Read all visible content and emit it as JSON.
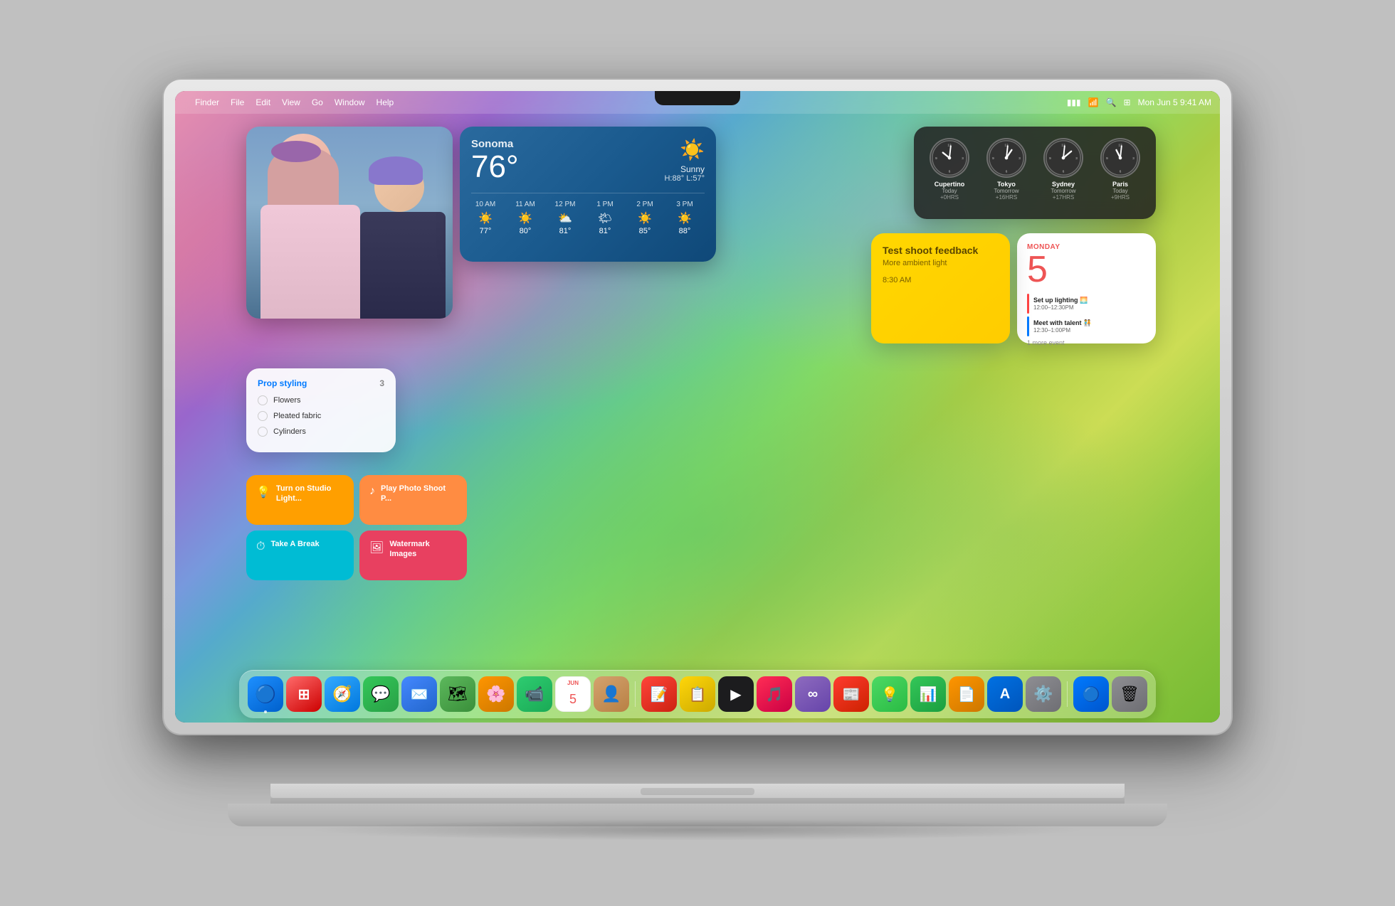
{
  "menubar": {
    "apple": "⌘",
    "finder": "Finder",
    "file": "File",
    "edit": "Edit",
    "view": "View",
    "go": "Go",
    "window": "Window",
    "help": "Help",
    "battery_icon": "🔋",
    "wifi_icon": "wifi",
    "search_icon": "search",
    "control_icon": "ctrl",
    "datetime": "Mon Jun 5  9:41 AM"
  },
  "weather": {
    "location": "Sonoma",
    "temperature": "76°",
    "condition": "Sunny",
    "high": "H:88°",
    "low": "L:57°",
    "forecast": [
      {
        "time": "10 AM",
        "icon": "☀️",
        "temp": "77°"
      },
      {
        "time": "11 AM",
        "icon": "☀️",
        "temp": "80°"
      },
      {
        "time": "12 PM",
        "icon": "⛅",
        "temp": "81°"
      },
      {
        "time": "1 PM",
        "icon": "🌤",
        "temp": "81°"
      },
      {
        "time": "2 PM",
        "icon": "☀️",
        "temp": "85°"
      },
      {
        "time": "3 PM",
        "icon": "☀️",
        "temp": "88°"
      }
    ]
  },
  "clocks": [
    {
      "city": "Cupertino",
      "day": "Today",
      "offset": "+0HRS",
      "hour_angle": "270",
      "min_angle": "300"
    },
    {
      "city": "Tokyo",
      "day": "Tomorrow",
      "offset": "+16HRS",
      "hour_angle": "30",
      "min_angle": "300"
    },
    {
      "city": "Sydney",
      "day": "Tomorrow",
      "offset": "+17HRS",
      "hour_angle": "60",
      "min_angle": "300"
    },
    {
      "city": "Paris",
      "day": "Today",
      "offset": "+9HRS",
      "hour_angle": "330",
      "min_angle": "300"
    }
  ],
  "calendar": {
    "day_name": "MONDAY",
    "date": "5",
    "events": [
      {
        "title": "Set up lighting 🌅",
        "time": "12:00–12:30PM",
        "color": "#ff4444"
      },
      {
        "title": "Meet with talent 🧑‍🤝‍🧑",
        "time": "12:30–1:00PM",
        "color": "#007aff"
      }
    ],
    "more": "1 more event"
  },
  "notes": {
    "title": "Test shoot feedback",
    "subtitle": "More ambient light",
    "time": "8:30 AM"
  },
  "reminders": {
    "title": "Prop styling",
    "count": "3",
    "items": [
      {
        "text": "Flowers"
      },
      {
        "text": "Pleated fabric"
      },
      {
        "text": "Cylinders"
      }
    ]
  },
  "shortcuts": [
    {
      "label": "Turn on Studio Light...",
      "icon": "💡",
      "color": "yellow"
    },
    {
      "label": "Play Photo Shoot P...",
      "icon": "♪",
      "color": "orange"
    },
    {
      "label": "Take A Break",
      "icon": "⏱",
      "color": "teal"
    },
    {
      "label": "Watermark Images",
      "icon": "🖼",
      "color": "pink"
    }
  ],
  "dock": {
    "icons": [
      {
        "name": "finder",
        "bg": "#1a73e8",
        "symbol": "🔵",
        "label": "Finder"
      },
      {
        "name": "launchpad",
        "bg": "#ff6b6b",
        "symbol": "⊞",
        "label": "Launchpad"
      },
      {
        "name": "safari",
        "bg": "#0099ff",
        "symbol": "🧭",
        "label": "Safari"
      },
      {
        "name": "messages",
        "bg": "#00c851",
        "symbol": "💬",
        "label": "Messages"
      },
      {
        "name": "mail",
        "bg": "#0077ff",
        "symbol": "✉️",
        "label": "Mail"
      },
      {
        "name": "maps",
        "bg": "#34c759",
        "symbol": "🗺",
        "label": "Maps"
      },
      {
        "name": "photos",
        "bg": "#ff9500",
        "symbol": "🌸",
        "label": "Photos"
      },
      {
        "name": "facetime",
        "bg": "#34c759",
        "symbol": "📹",
        "label": "FaceTime"
      },
      {
        "name": "calendar",
        "bg": "#ff3b30",
        "symbol": "📅",
        "label": "Calendar"
      },
      {
        "name": "contacts",
        "bg": "#c8a26e",
        "symbol": "👤",
        "label": "Contacts"
      },
      {
        "name": "reminders",
        "bg": "#ff3b30",
        "symbol": "📝",
        "label": "Reminders"
      },
      {
        "name": "notes2",
        "bg": "#ffd60a",
        "symbol": "📋",
        "label": "Notes"
      },
      {
        "name": "apptv",
        "bg": "#1c1c1e",
        "symbol": "▶",
        "label": "Apple TV"
      },
      {
        "name": "music",
        "bg": "#ff2d55",
        "symbol": "🎵",
        "label": "Music"
      },
      {
        "name": "freeform",
        "bg": "#7c5cbf",
        "symbol": "∞",
        "label": "Freeform"
      },
      {
        "name": "news",
        "bg": "#ff3b30",
        "symbol": "📰",
        "label": "News"
      },
      {
        "name": "tips",
        "bg": "#4cd964",
        "symbol": "💡",
        "label": "Tips"
      },
      {
        "name": "numbers",
        "bg": "#34c759",
        "symbol": "📊",
        "label": "Numbers"
      },
      {
        "name": "pages",
        "bg": "#ff9500",
        "symbol": "📄",
        "label": "Pages"
      },
      {
        "name": "appstore",
        "bg": "#0071e3",
        "symbol": "A",
        "label": "App Store"
      },
      {
        "name": "settings",
        "bg": "#8e8e93",
        "symbol": "⚙️",
        "label": "System Settings"
      },
      {
        "name": "appstore2",
        "bg": "#0071e3",
        "symbol": "🔵",
        "label": "App"
      },
      {
        "name": "trash",
        "bg": "#8e8e93",
        "symbol": "🗑",
        "label": "Trash"
      }
    ]
  }
}
